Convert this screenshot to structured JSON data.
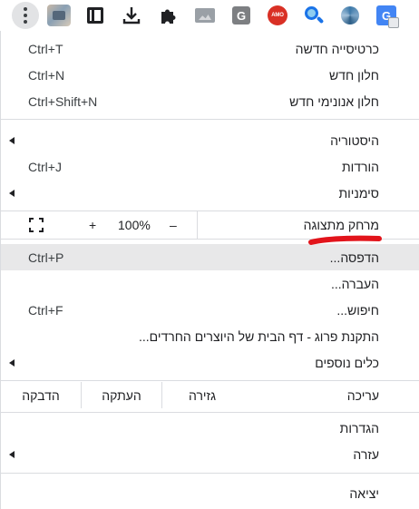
{
  "toolbar": {
    "icons": [
      "more-vert-icon",
      "profile-avatar-icon",
      "side-panel-icon",
      "download-icon",
      "extensions-puzzle-icon",
      "image-extension-icon",
      "g-extension-icon",
      "red-badge-extension-icon",
      "lens-extension-icon",
      "swirl-extension-icon",
      "google-translate-icon"
    ],
    "g_letter": "G",
    "red_badge_text": "AMO",
    "translate_letter": "G"
  },
  "menu": {
    "new_tab": {
      "label": "כרטיסייה חדשה",
      "shortcut": "Ctrl+T"
    },
    "new_window": {
      "label": "חלון חדש",
      "shortcut": "Ctrl+N"
    },
    "new_incognito": {
      "label": "חלון אנונימי חדש",
      "shortcut": "Ctrl+Shift+N"
    },
    "history": {
      "label": "היסטוריה"
    },
    "downloads": {
      "label": "הורדות",
      "shortcut": "Ctrl+J"
    },
    "bookmarks": {
      "label": "סימניות"
    },
    "zoom": {
      "label": "מרחק מתצוגה",
      "minus": "–",
      "value": "100%",
      "plus": "+"
    },
    "print": {
      "label": "הדפסה...",
      "shortcut": "Ctrl+P"
    },
    "cast": {
      "label": "העברה..."
    },
    "find": {
      "label": "חיפוש...",
      "shortcut": "Ctrl+F"
    },
    "install": {
      "label": "התקנת פרוג - דף הבית של היוצרים החרדים..."
    },
    "more_tools": {
      "label": "כלים נוספים"
    },
    "edit": {
      "label": "עריכה",
      "cut": "גזירה",
      "copy": "העתקה",
      "paste": "הדבקה"
    },
    "settings": {
      "label": "הגדרות"
    },
    "help": {
      "label": "עזרה"
    },
    "exit": {
      "label": "יציאה"
    }
  },
  "colors": {
    "highlight": "#e8e8e9",
    "separator": "#dadce0",
    "annotation_red": "#e2141b"
  }
}
